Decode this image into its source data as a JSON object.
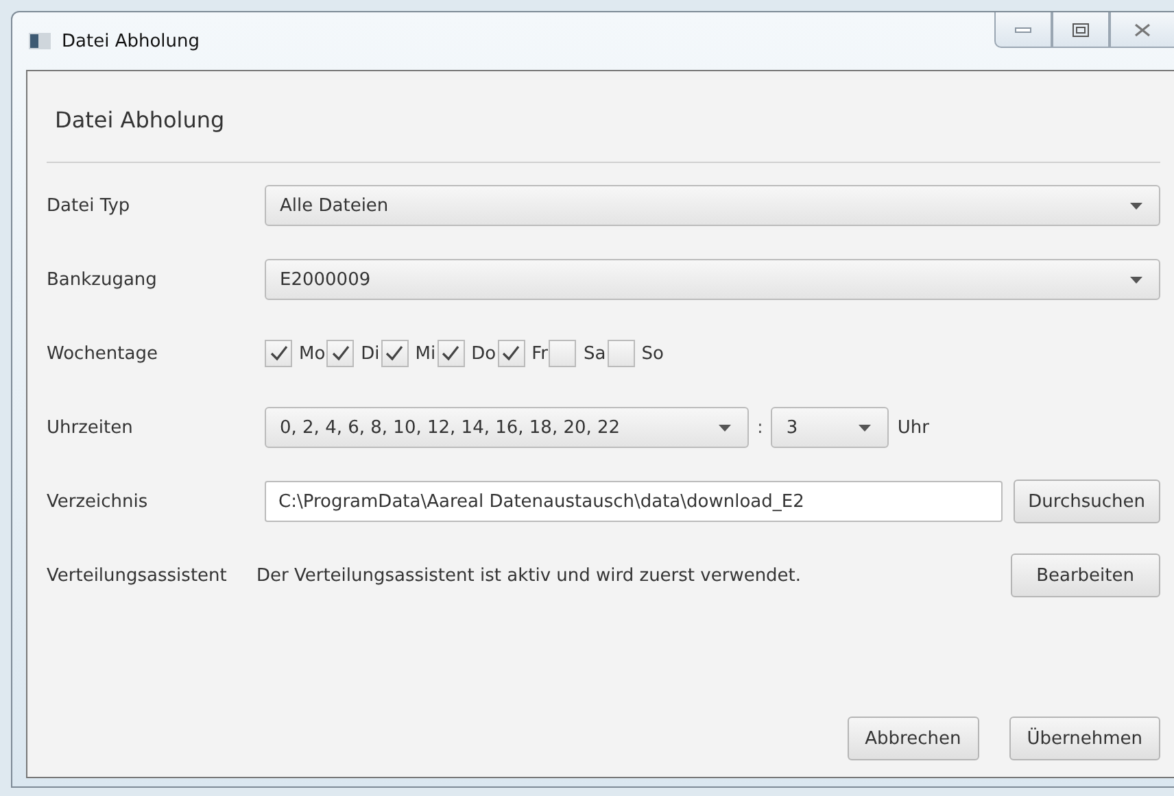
{
  "window": {
    "title": "Datei Abholung"
  },
  "header": "Datei Abholung",
  "rows": [
    {
      "kind": "select",
      "label": "Datei Typ",
      "value": "Alle Dateien"
    },
    {
      "kind": "select",
      "label": "Bankzugang",
      "value": "E2000009"
    },
    {
      "kind": "days",
      "label": "Wochentage",
      "days": [
        {
          "label": "Mo",
          "checked": true
        },
        {
          "label": "Di",
          "checked": true
        },
        {
          "label": "Mi",
          "checked": true
        },
        {
          "label": "Do",
          "checked": true
        },
        {
          "label": "Fr",
          "checked": true
        },
        {
          "label": "Sa",
          "checked": false
        },
        {
          "label": "So",
          "checked": false
        }
      ]
    },
    {
      "kind": "time",
      "label": "Uhrzeiten",
      "hours": "0, 2, 4, 6, 8, 10, 12, 14, 16, 18, 20, 22",
      "separator": ":",
      "minute": "3",
      "unit": "Uhr"
    },
    {
      "kind": "path",
      "label": "Verzeichnis",
      "value": "C:\\ProgramData\\Aareal Datenaustausch\\data\\download_E2",
      "button": "Durchsuchen"
    },
    {
      "kind": "info",
      "label": "Verteilungsassistent",
      "text": "Der Verteilungsassistent ist aktiv und wird zuerst verwendet.",
      "button": "Bearbeiten"
    }
  ],
  "buttons": [
    "Abbrechen",
    "Übernehmen"
  ]
}
